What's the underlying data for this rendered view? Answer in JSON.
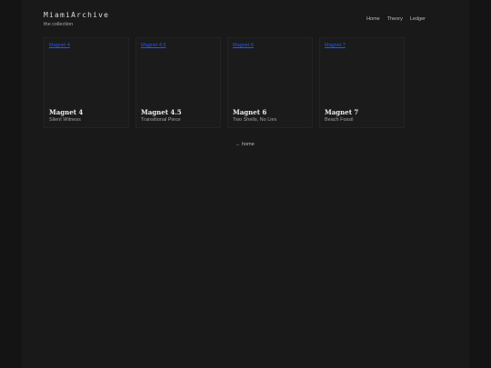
{
  "site": {
    "brand": "MiamiArchive",
    "tagline": "the collection"
  },
  "nav": {
    "items": [
      "Home",
      "Theory",
      "Ledger"
    ]
  },
  "cards": [
    {
      "image_alt": "Magnet 4",
      "title": "Magnet 4",
      "subtitle": "Silent Witness"
    },
    {
      "image_alt": "Magnet 4.5",
      "title": "Magnet 4.5",
      "subtitle": "Transitional Piece"
    },
    {
      "image_alt": "Magnet 6",
      "title": "Magnet 6",
      "subtitle": "Two Shells, No Lies"
    },
    {
      "image_alt": "Magnet 7",
      "title": "Magnet 7",
      "subtitle": "Beach Fossil"
    }
  ],
  "footer": {
    "back_link": "← home"
  },
  "colors": {
    "background": "#141414",
    "panel": "#191919",
    "card": "#1b1b1b",
    "link_blue": "#1b56ff"
  }
}
